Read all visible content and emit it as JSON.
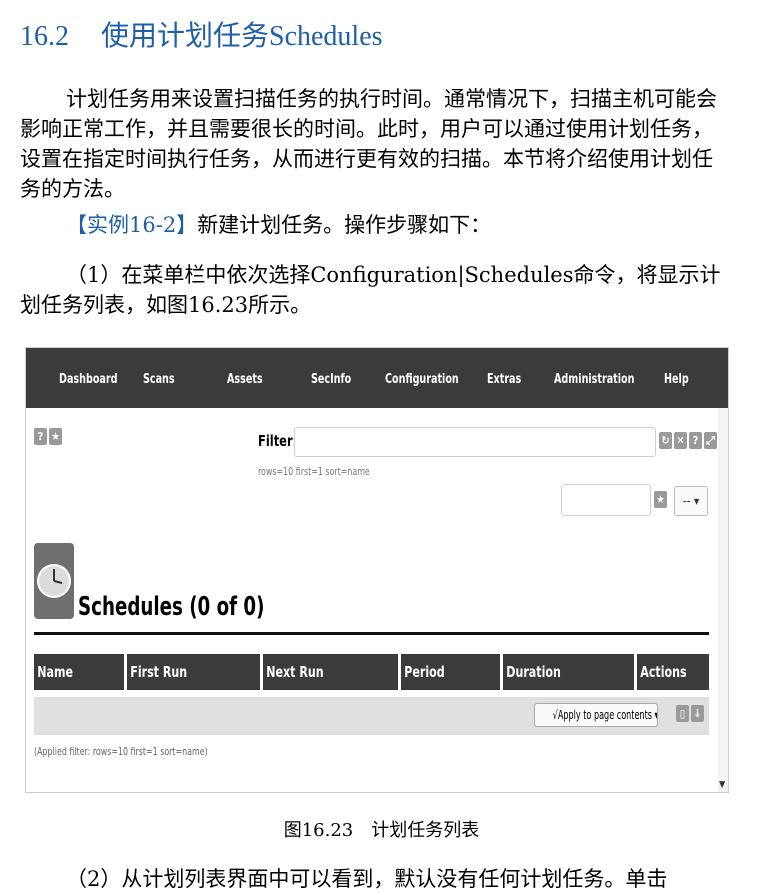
{
  "heading": {
    "number": "16.2",
    "title": "使用计划任务Schedules"
  },
  "paragraph1": "计划任务用来设置扫描任务的执行时间。通常情况下，扫描主机可能会影响正常工作，并且需要很长的时间。此时，用户可以通过使用计划任务，设置在指定时间执行任务，从而进行更有效的扫描。本节将介绍使用计划任务的方法。",
  "example": {
    "tag": "【实例16-2】",
    "text": "新建计划任务。操作步骤如下："
  },
  "step1": "（1）在菜单栏中依次选择Configuration|Schedules命令，将显示计划任务列表，如图16.23所示。",
  "screenshot": {
    "nav": [
      "Dashboard",
      "Scans",
      "Assets",
      "SecInfo",
      "Configuration",
      "Extras",
      "Administration",
      "Help"
    ],
    "help_glyph": "?",
    "star_glyph": "★",
    "filter_label": "Filter:",
    "filter_value": "",
    "filter_meta": "rows=10 first=1 sort=name",
    "filter_select_value": "--",
    "page_title": "Schedules (0 of 0)",
    "columns": [
      "Name",
      "First Run",
      "Next Run",
      "Period",
      "Duration",
      "Actions"
    ],
    "apply_label": "√Apply to page contents ▾",
    "applied_filter": "(Applied filter: rows=10 first=1 sort=name)",
    "colors": {
      "navbar": "#3b3b3b",
      "header": "#3b3b3b",
      "icon": "#9a9a9a"
    }
  },
  "caption": "图16.23　计划任务列表",
  "step2": "（2）从计划列表界面中可以看到，默认没有任何计划任务。单击"
}
